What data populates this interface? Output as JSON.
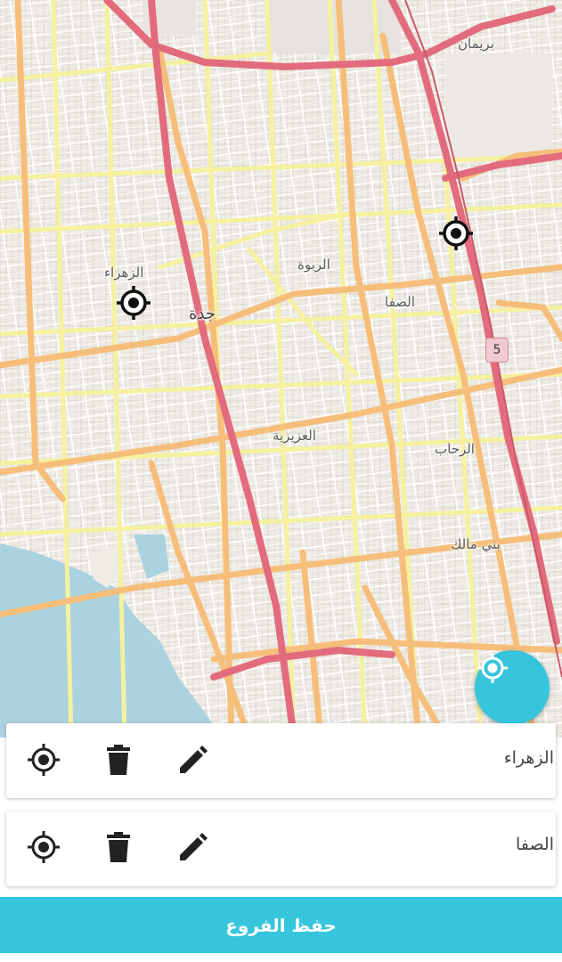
{
  "map": {
    "labels": {
      "bariman": "بريمان",
      "zahraa": "الزهراء",
      "jeddah": "جدة",
      "rabwa": "الربوة",
      "safa": "الصفا",
      "aziziya": "العزيزية",
      "rehab": "الرحاب",
      "bani_malik": "بني مالك"
    },
    "road_shield": "5"
  },
  "branches": [
    {
      "name": "الزهراء"
    },
    {
      "name": "الصفا"
    }
  ],
  "icons": {
    "locate": "crosshair-icon",
    "delete": "trash-icon",
    "edit": "pencil-icon",
    "marker": "location-marker-icon",
    "my_location": "my-location-icon"
  },
  "colors": {
    "accent": "#36c5dc",
    "primary_road": "#e26c7d",
    "secondary_road": "#f6be7b",
    "tertiary_road": "#f5f19f",
    "water": "#aad3df"
  },
  "footer": {
    "save_label": "حفظ الفروع"
  }
}
